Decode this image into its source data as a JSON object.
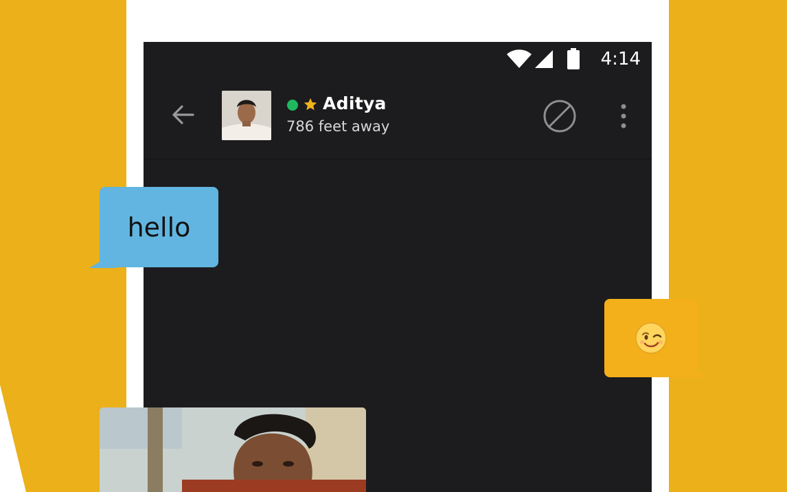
{
  "status_bar": {
    "time": "4:14",
    "icons": [
      "wifi-icon",
      "signal-icon",
      "battery-icon"
    ]
  },
  "chat_header": {
    "back_icon": "arrow-left-icon",
    "avatar": "profile-photo",
    "online_status": "online",
    "favorite_icon": "star-icon",
    "name": "Aditya",
    "distance": "786 feet away",
    "block_icon": "block-icon",
    "more_icon": "more-vertical-icon"
  },
  "messages": [
    {
      "from": "received",
      "text": "hello"
    },
    {
      "from": "sent",
      "emoji": "😉"
    },
    {
      "from": "received",
      "type": "photo"
    }
  ],
  "colors": {
    "background": "#EBB01A",
    "screen": "#1C1C1E",
    "received_bubble": "#62B5E0",
    "sent_bubble": "#F4B01B",
    "online": "#1FB85E"
  }
}
